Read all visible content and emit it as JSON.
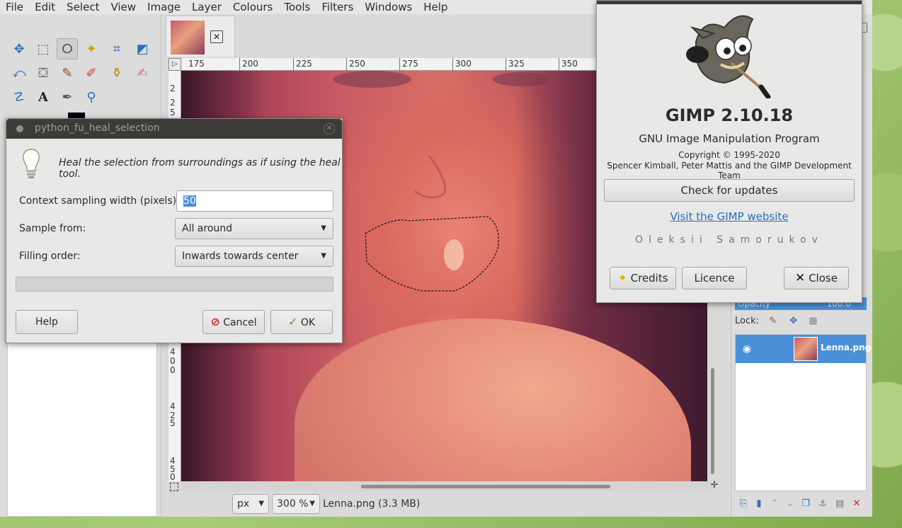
{
  "menubar": [
    "File",
    "Edit",
    "Select",
    "View",
    "Image",
    "Layer",
    "Colours",
    "Tools",
    "Filters",
    "Windows",
    "Help"
  ],
  "rulers": {
    "horizontal": [
      "175",
      "200",
      "225",
      "250",
      "275",
      "300",
      "325",
      "350"
    ],
    "vertical": [
      "2",
      "2",
      "5",
      "4",
      "0",
      "0",
      "4",
      "2",
      "5",
      "4",
      "5",
      "0"
    ]
  },
  "statusbar": {
    "unit": "px",
    "zoom": "300 %",
    "image_info": "Lenna.png (3.3 MB)"
  },
  "layers": {
    "opacity_label": "Opacity",
    "opacity_value": "100.0",
    "lock_label": "Lock:",
    "layer_name": "Lenna.png"
  },
  "about": {
    "title": "GIMP 2.10.18",
    "subtitle": "GNU Image Manipulation Program",
    "copyright": "Copyright © 1995-2020",
    "authors": "Spencer Kimball, Peter Mattis and the GIMP Development Team",
    "check_updates": "Check for updates",
    "website_link": "Visit the GIMP website",
    "author_name": "Oleksii Samorukov",
    "credits_label": "Credits",
    "licence_label": "Licence",
    "close_label": "Close"
  },
  "heal_dialog": {
    "title": "python_fu_heal_selection",
    "description": "Heal the selection from surroundings as if using the heal tool.",
    "width_label": "Context sampling width (pixels):",
    "width_value": "50",
    "sample_label": "Sample from:",
    "sample_value": "All around",
    "order_label": "Filling order:",
    "order_value": "Inwards towards center",
    "help_label": "Help",
    "cancel_label": "Cancel",
    "ok_label": "OK"
  },
  "colors": {
    "selection_blue": "#4a90d9",
    "titlebar_dark": "#3c3b37",
    "link_blue": "#2a6dbf"
  }
}
